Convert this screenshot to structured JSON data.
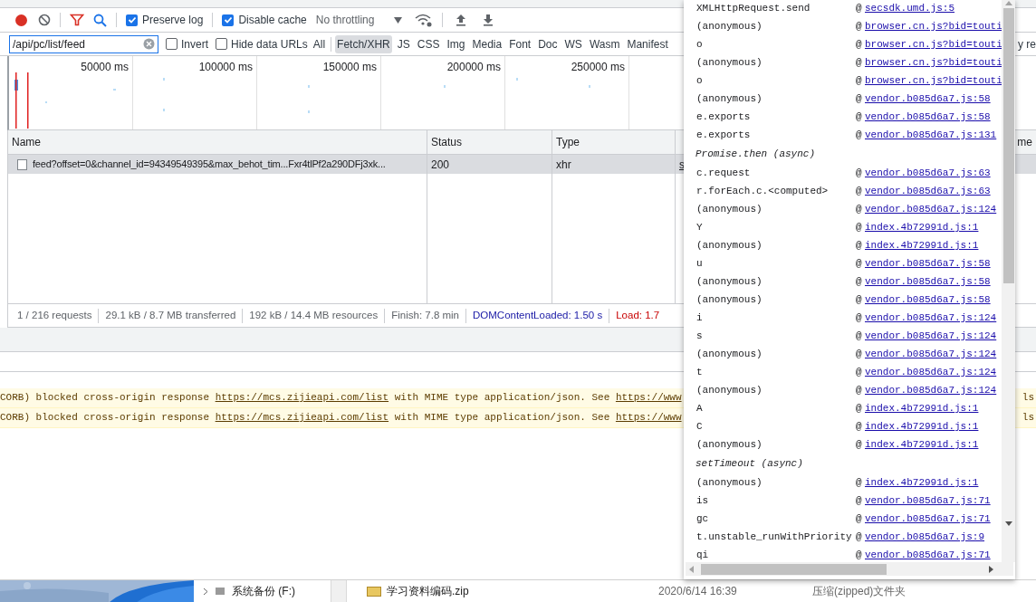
{
  "toolbar": {
    "preserve_log": {
      "label": "Preserve log",
      "checked": true
    },
    "disable_cache": {
      "label": "Disable cache",
      "checked": true
    },
    "throttling": "No throttling"
  },
  "filter": {
    "value": "/api/pc/list/feed",
    "invert": {
      "label": "Invert",
      "checked": false
    },
    "hide_data_urls": {
      "label": "Hide data URLs",
      "checked": false
    },
    "types": [
      {
        "label": "All",
        "selected": false
      },
      {
        "label": "Fetch/XHR",
        "selected": true
      },
      {
        "label": "JS",
        "selected": false
      },
      {
        "label": "CSS",
        "selected": false
      },
      {
        "label": "Img",
        "selected": false
      },
      {
        "label": "Media",
        "selected": false
      },
      {
        "label": "Font",
        "selected": false
      },
      {
        "label": "Doc",
        "selected": false
      },
      {
        "label": "WS",
        "selected": false
      },
      {
        "label": "Wasm",
        "selected": false
      },
      {
        "label": "Manifest",
        "selected": false
      }
    ],
    "right_fragment": "y re"
  },
  "timeline": {
    "ticks": [
      "50000 ms",
      "100000 ms",
      "150000 ms",
      "200000 ms",
      "250000 ms"
    ]
  },
  "table": {
    "columns": [
      "Name",
      "Status",
      "Type"
    ],
    "right_fragment": "me",
    "rows": [
      {
        "name": "feed?offset=0&channel_id=94349549395&max_behot_tim...Fxr4tlPf2a290DFj3xk...",
        "status": "200",
        "type": "xhr",
        "column_4": "s",
        "selected": true
      }
    ]
  },
  "status_bar": [
    {
      "kind": "plain",
      "text": "1 / 216 requests"
    },
    {
      "kind": "plain",
      "text": "29.1 kB / 8.7 MB transferred"
    },
    {
      "kind": "plain",
      "text": "192 kB / 14.4 MB resources"
    },
    {
      "kind": "plain",
      "text": "Finish: 7.8 min"
    },
    {
      "kind": "dom",
      "text": "DOMContentLoaded: 1.50 s"
    },
    {
      "kind": "load",
      "text": "Load: 1.7"
    }
  ],
  "console_messages": [
    {
      "parts": [
        {
          "kind": "text",
          "text": "CORB) blocked cross-origin response "
        },
        {
          "kind": "link",
          "text": "https://mcs.zijieapi.com/list"
        },
        {
          "kind": "text",
          "text": " with MIME type application/json. See "
        },
        {
          "kind": "link",
          "text": "https://www"
        }
      ],
      "right_fragment": "ls"
    },
    {
      "parts": [
        {
          "kind": "text",
          "text": "CORB) blocked cross-origin response "
        },
        {
          "kind": "link",
          "text": "https://mcs.zijieapi.com/list"
        },
        {
          "kind": "text",
          "text": " with MIME type application/json. See "
        },
        {
          "kind": "link",
          "text": "https://www"
        }
      ],
      "right_fragment": "ls"
    }
  ],
  "call_stack": [
    {
      "kind": "frame",
      "function": "XMLHttpRequest.send",
      "prefix": "@",
      "location": "secsdk.umd.js:5"
    },
    {
      "kind": "frame",
      "function": "(anonymous)",
      "prefix": "@",
      "location": "browser.cn.js?bid=touti"
    },
    {
      "kind": "frame",
      "function": "o",
      "prefix": "@",
      "location": "browser.cn.js?bid=touti"
    },
    {
      "kind": "frame",
      "function": "(anonymous)",
      "prefix": "@",
      "location": "browser.cn.js?bid=touti"
    },
    {
      "kind": "frame",
      "function": "o",
      "prefix": "@",
      "location": "browser.cn.js?bid=touti"
    },
    {
      "kind": "frame",
      "function": "(anonymous)",
      "prefix": "@",
      "location": "vendor.b085d6a7.js:58"
    },
    {
      "kind": "frame",
      "function": "e.exports",
      "prefix": "@",
      "location": "vendor.b085d6a7.js:58"
    },
    {
      "kind": "frame",
      "function": "e.exports",
      "prefix": "@",
      "location": "vendor.b085d6a7.js:131"
    },
    {
      "kind": "async",
      "label": "Promise.then (async)"
    },
    {
      "kind": "frame",
      "function": "c.request",
      "prefix": "@",
      "location": "vendor.b085d6a7.js:63"
    },
    {
      "kind": "frame",
      "function": "r.forEach.c.<computed>",
      "prefix": "@",
      "location": "vendor.b085d6a7.js:63"
    },
    {
      "kind": "frame",
      "function": "(anonymous)",
      "prefix": "@",
      "location": "vendor.b085d6a7.js:124"
    },
    {
      "kind": "frame",
      "function": "Y",
      "prefix": "@",
      "location": "index.4b72991d.js:1"
    },
    {
      "kind": "frame",
      "function": "(anonymous)",
      "prefix": "@",
      "location": "index.4b72991d.js:1"
    },
    {
      "kind": "frame",
      "function": "u",
      "prefix": "@",
      "location": "vendor.b085d6a7.js:58"
    },
    {
      "kind": "frame",
      "function": "(anonymous)",
      "prefix": "@",
      "location": "vendor.b085d6a7.js:58"
    },
    {
      "kind": "frame",
      "function": "(anonymous)",
      "prefix": "@",
      "location": "vendor.b085d6a7.js:58"
    },
    {
      "kind": "frame",
      "function": "i",
      "prefix": "@",
      "location": "vendor.b085d6a7.js:124"
    },
    {
      "kind": "frame",
      "function": "s",
      "prefix": "@",
      "location": "vendor.b085d6a7.js:124"
    },
    {
      "kind": "frame",
      "function": "(anonymous)",
      "prefix": "@",
      "location": "vendor.b085d6a7.js:124"
    },
    {
      "kind": "frame",
      "function": "t",
      "prefix": "@",
      "location": "vendor.b085d6a7.js:124"
    },
    {
      "kind": "frame",
      "function": "(anonymous)",
      "prefix": "@",
      "location": "vendor.b085d6a7.js:124"
    },
    {
      "kind": "frame",
      "function": "A",
      "prefix": "@",
      "location": "index.4b72991d.js:1"
    },
    {
      "kind": "frame",
      "function": "C",
      "prefix": "@",
      "location": "index.4b72991d.js:1"
    },
    {
      "kind": "frame",
      "function": "(anonymous)",
      "prefix": "@",
      "location": "index.4b72991d.js:1"
    },
    {
      "kind": "async",
      "label": "setTimeout (async)"
    },
    {
      "kind": "frame",
      "function": "(anonymous)",
      "prefix": "@",
      "location": "index.4b72991d.js:1"
    },
    {
      "kind": "frame",
      "function": "is",
      "prefix": "@",
      "location": "vendor.b085d6a7.js:71"
    },
    {
      "kind": "frame",
      "function": "gc",
      "prefix": "@",
      "location": "vendor.b085d6a7.js:71"
    },
    {
      "kind": "frame",
      "function": "t.unstable_runWithPriority",
      "prefix": "@",
      "location": "vendor.b085d6a7.js:9"
    },
    {
      "kind": "frame",
      "function": "qi",
      "prefix": "@",
      "location": "vendor.b085d6a7.js:71"
    }
  ],
  "desktop": {
    "drive": "系统备份 (F:)",
    "file_name": "学习资料编码.zip",
    "file_date": "2020/6/14 16:39",
    "file_type": "压缩(zipped)文件夹"
  }
}
